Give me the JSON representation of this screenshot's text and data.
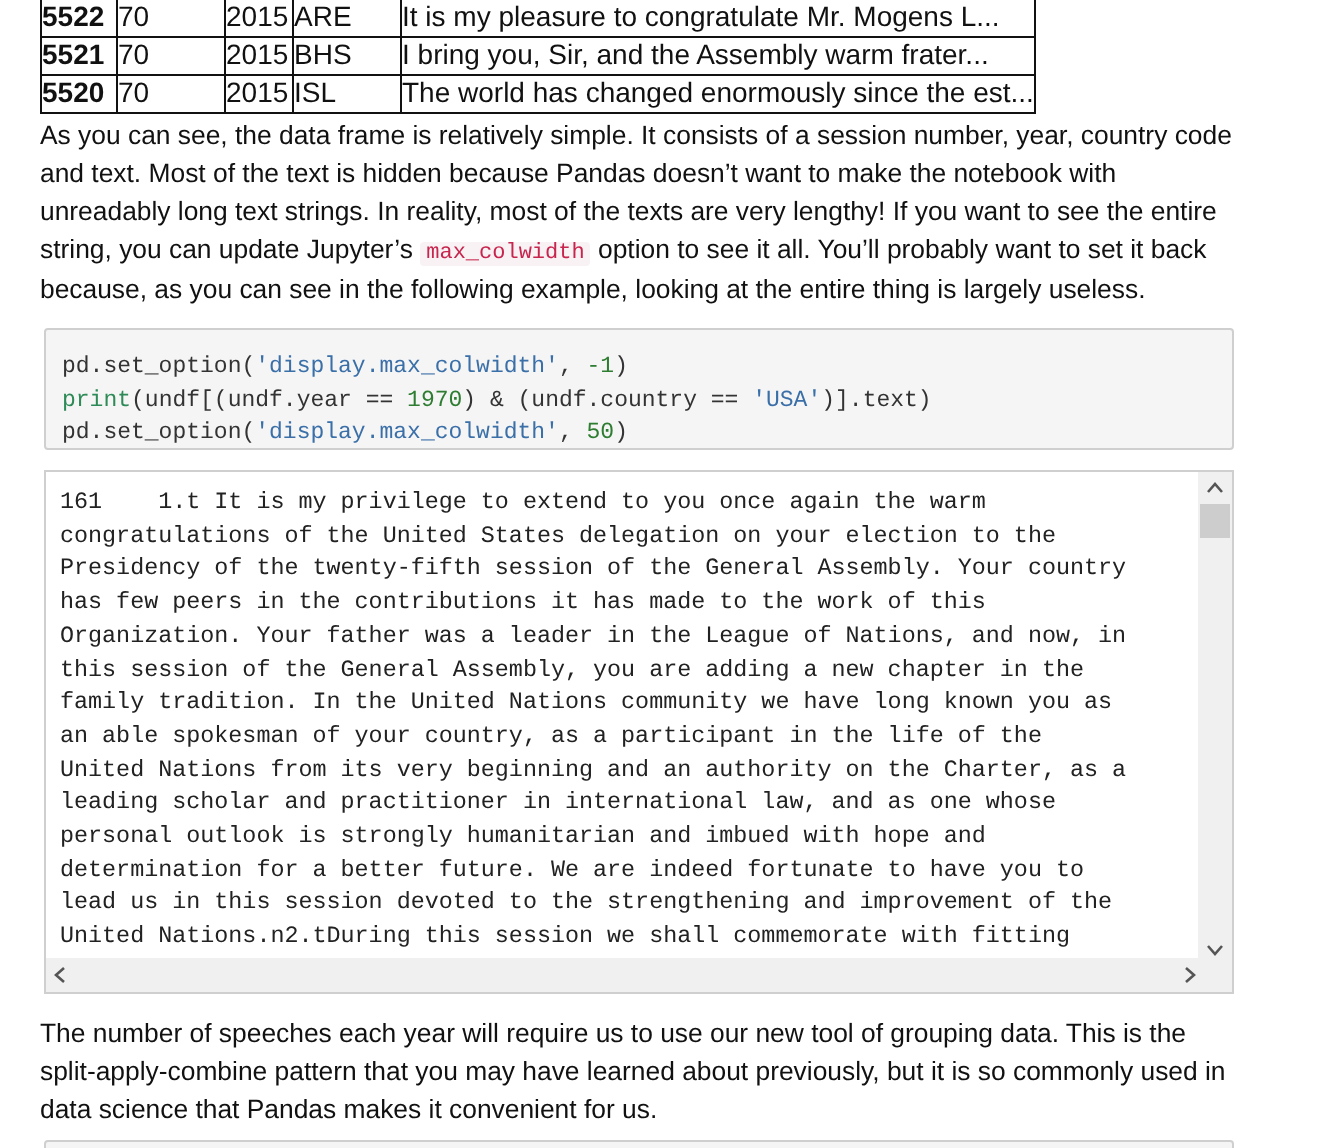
{
  "table": {
    "rows": [
      {
        "index": "5522",
        "cells": [
          "70",
          "2015",
          "ARE",
          "It is my pleasure to congratulate Mr. Mogens L..."
        ]
      },
      {
        "index": "5521",
        "cells": [
          "70",
          "2015",
          "BHS",
          "I bring you, Sir, and the Assembly warm frater..."
        ]
      },
      {
        "index": "5520",
        "cells": [
          "70",
          "2015",
          "ISL",
          "The world has changed enormously since the est..."
        ]
      }
    ]
  },
  "paragraph_1": {
    "before": "As you can see, the data frame is relatively simple. It consists of a session number, year, country code and text. Most of the text is hidden because Pandas doesn’t want to make the notebook with unreadably long text strings. In reality, most of the texts are very lengthy! If you want to see the entire string, you can update Jupyter’s",
    "code": "max_colwidth",
    "after": "option to see it all. You’ll probably want to set it back because, as you can see in the following example, looking at the entire thing is largely useless."
  },
  "code_cell": {
    "lines": [
      [
        {
          "kind": "plain",
          "text": "pd.set_option("
        },
        {
          "kind": "string",
          "text": "'display.max_colwidth'"
        },
        {
          "kind": "plain",
          "text": ", "
        },
        {
          "kind": "number",
          "text": "-1"
        },
        {
          "kind": "plain",
          "text": ")"
        }
      ],
      [
        {
          "kind": "builtin",
          "text": "print"
        },
        {
          "kind": "plain",
          "text": "(undf[(undf.year == "
        },
        {
          "kind": "number",
          "text": "1970"
        },
        {
          "kind": "plain",
          "text": ") & (undf.country == "
        },
        {
          "kind": "string",
          "text": "'USA'"
        },
        {
          "kind": "plain",
          "text": ")].text)"
        }
      ],
      [
        {
          "kind": "plain",
          "text": "pd.set_option("
        },
        {
          "kind": "string",
          "text": "'display.max_colwidth'"
        },
        {
          "kind": "plain",
          "text": ", "
        },
        {
          "kind": "number",
          "text": "50"
        },
        {
          "kind": "plain",
          "text": ")"
        }
      ]
    ]
  },
  "output": {
    "lines": [
      "161    1.t It is my privilege to extend to you once again the warm",
      "congratulations of the United States delegation on your election to the",
      "Presidency of the twenty-fifth session of the General Assembly. Your country",
      "has few peers in the contributions it has made to the work of this",
      "Organization. Your father was a leader in the League of Nations, and now, in",
      "this session of the General Assembly, you are adding a new chapter in the",
      "family tradition. In the United Nations community we have long known you as",
      "an able spokesman of your country, as a participant in the life of the",
      "United Nations from its very beginning and an authority on the Charter, as a",
      "leading scholar and practitioner in international law, and as one whose",
      "personal outlook is strongly humanitarian and imbued with hope and",
      "determination for a better future. We are indeed fortunate to have you to",
      "lead us in this session devoted to the strengthening and improvement of the",
      "United Nations.n2.tDuring this session we shall commemorate with fitting"
    ]
  },
  "paragraph_2": "The number of speeches each year will require us to use our new tool of grouping data. This is the split-apply-combine pattern that you may have learned about previously, but it is so commonly used in data science that Pandas makes it convenient for us."
}
